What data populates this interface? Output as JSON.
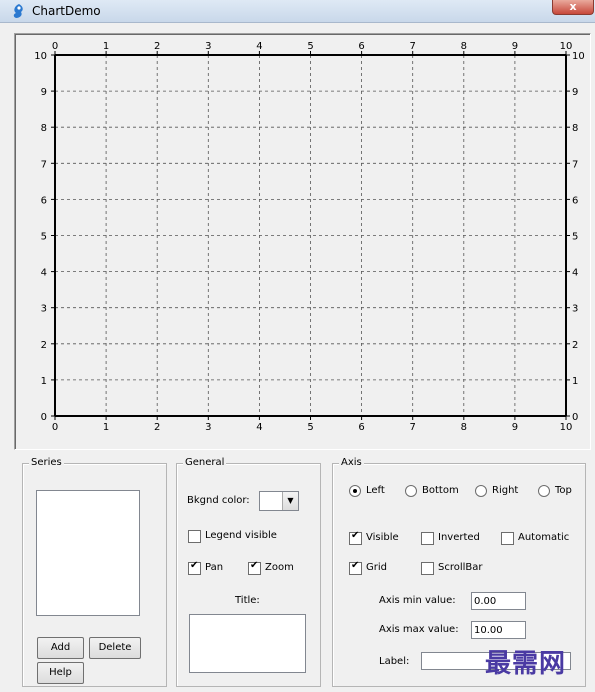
{
  "window": {
    "title": "ChartDemo",
    "close_glyph": "x"
  },
  "chart_data": {
    "type": "line",
    "x_ticks": [
      "0",
      "1",
      "2",
      "3",
      "4",
      "5",
      "6",
      "7",
      "8",
      "9",
      "10"
    ],
    "y_ticks": [
      "0",
      "1",
      "2",
      "3",
      "4",
      "5",
      "6",
      "7",
      "8",
      "9",
      "10"
    ],
    "xlim": [
      0,
      10
    ],
    "ylim": [
      0,
      10
    ],
    "grid": true,
    "axes_shown": [
      "left",
      "bottom",
      "top",
      "right"
    ],
    "series": []
  },
  "series_group": {
    "label": "Series",
    "add": "Add",
    "delete": "Delete",
    "help": "Help"
  },
  "general_group": {
    "label": "General",
    "bkgnd_color_label": "Bkgnd color:",
    "legend_visible": {
      "label": "Legend visible",
      "checked": false
    },
    "pan": {
      "label": "Pan",
      "checked": true
    },
    "zoom": {
      "label": "Zoom",
      "checked": true
    },
    "title_label": "Title:"
  },
  "axis_group": {
    "label": "Axis",
    "radios": [
      {
        "label": "Left",
        "checked": true
      },
      {
        "label": "Bottom",
        "checked": false
      },
      {
        "label": "Right",
        "checked": false
      },
      {
        "label": "Top",
        "checked": false
      }
    ],
    "visible": {
      "label": "Visible",
      "checked": true
    },
    "inverted": {
      "label": "Inverted",
      "checked": false
    },
    "automatic": {
      "label": "Automatic",
      "checked": false
    },
    "grid": {
      "label": "Grid",
      "checked": true
    },
    "scrollbar": {
      "label": "ScrollBar",
      "checked": false
    },
    "min_label": "Axis min value:",
    "min_value": "0.00",
    "max_label": "Axis max value:",
    "max_value": "10.00",
    "label_label": "Label:",
    "label_value": ""
  },
  "watermark": "最需网"
}
